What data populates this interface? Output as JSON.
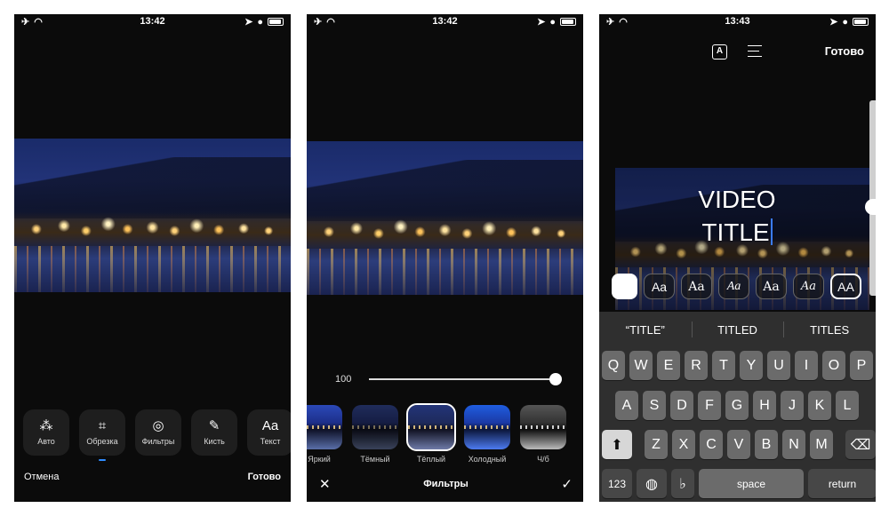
{
  "status_bars": [
    {
      "time": "13:42"
    },
    {
      "time": "13:42"
    },
    {
      "time": "13:43"
    }
  ],
  "phone1": {
    "tools": [
      {
        "label": "Авто",
        "icon": "magic-wand-icon"
      },
      {
        "label": "Обрезка",
        "icon": "crop-icon"
      },
      {
        "label": "Фильтры",
        "icon": "filters-icon"
      },
      {
        "label": "Кисть",
        "icon": "brush-icon"
      },
      {
        "label": "Текст",
        "icon": "text-icon",
        "glyph": "Aa"
      }
    ],
    "cancel_label": "Отмена",
    "done_label": "Готово"
  },
  "phone2": {
    "intensity_value": "100",
    "intensity_fraction": 1.0,
    "filters": [
      {
        "label": "Яркий"
      },
      {
        "label": "Тёмный"
      },
      {
        "label": "Тёплый"
      },
      {
        "label": "Холодный"
      },
      {
        "label": "Ч/б"
      }
    ],
    "selected_filter": "Тёплый",
    "title": "Фильтры"
  },
  "phone3": {
    "done_label": "Готово",
    "text_icon_glyph": "A",
    "title_line1": "VIDEO",
    "title_line2": "TITLE",
    "font_samples": [
      "Aa",
      "Aa",
      "Aa",
      "Aa",
      "Aa",
      "AA"
    ],
    "suggestions": [
      "“TITLE”",
      "TITLED",
      "TITLES"
    ],
    "keyboard": {
      "row1": [
        "Q",
        "W",
        "E",
        "R",
        "T",
        "Y",
        "U",
        "I",
        "O",
        "P"
      ],
      "row2": [
        "A",
        "S",
        "D",
        "F",
        "G",
        "H",
        "J",
        "K",
        "L"
      ],
      "row3": [
        "Z",
        "X",
        "C",
        "V",
        "B",
        "N",
        "M"
      ],
      "numbers_label": "123",
      "space_label": "space",
      "return_label": "return"
    }
  },
  "colors": {
    "accent_blue": "#2e8cff",
    "phone_bg": "#0b0b0b",
    "keyboard_bg": "#2f2f2f"
  }
}
